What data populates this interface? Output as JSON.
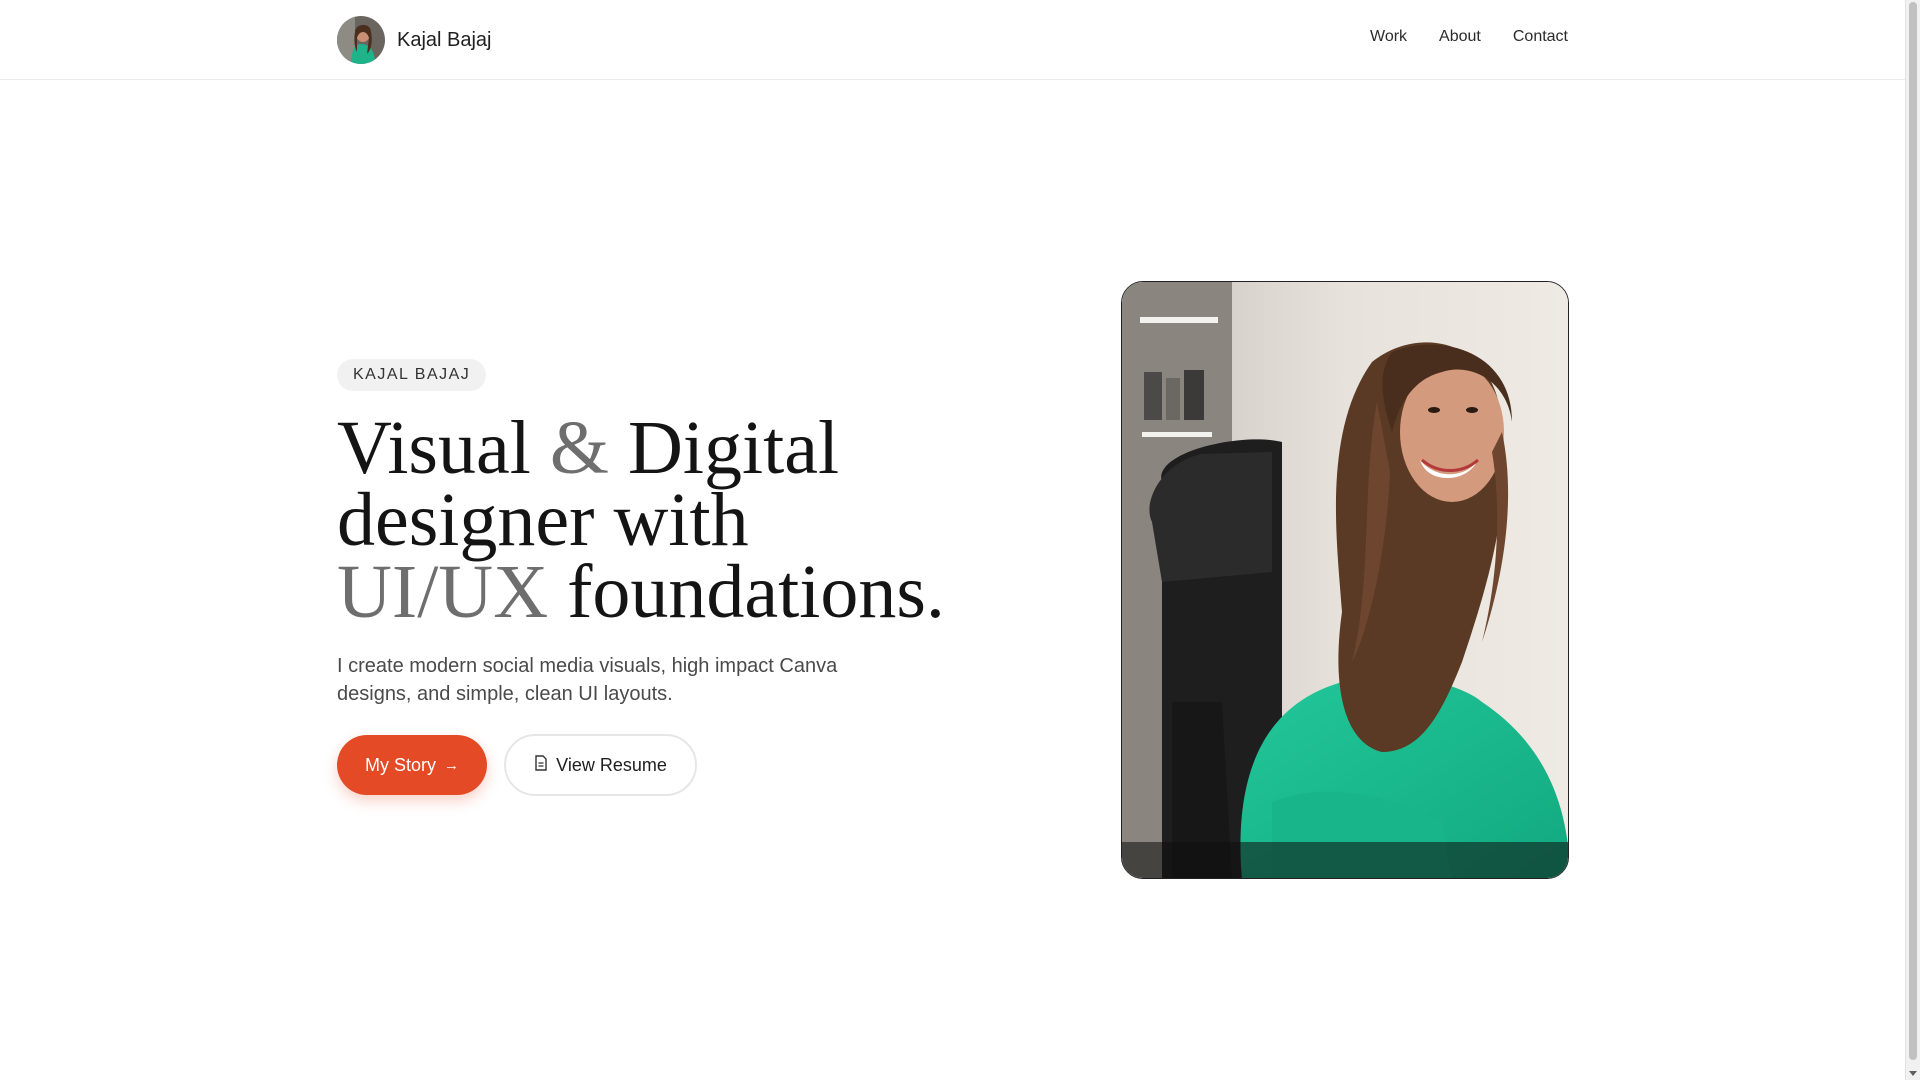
{
  "header": {
    "brand_name": "Kajal Bajaj",
    "nav": [
      {
        "label": "Work"
      },
      {
        "label": "About"
      },
      {
        "label": "Contact"
      }
    ]
  },
  "hero": {
    "badge": "KAJAL BAJAJ",
    "headline": {
      "line1_a": "Visual ",
      "line1_amp": "&",
      "line1_b": " Digital",
      "line2": "designer with",
      "line3_muted": "UI/UX",
      "line3_b": " foundations."
    },
    "subtitle": "I create modern social media visuals, high impact Canva designs, and simple, clean UI layouts.",
    "primary_button": {
      "label": "My Story",
      "icon": "arrow-right-icon"
    },
    "secondary_button": {
      "label": "View Resume",
      "icon": "document-icon"
    }
  },
  "colors": {
    "accent": "#e34a25",
    "text": "#141414",
    "muted": "#6e6e6e"
  }
}
